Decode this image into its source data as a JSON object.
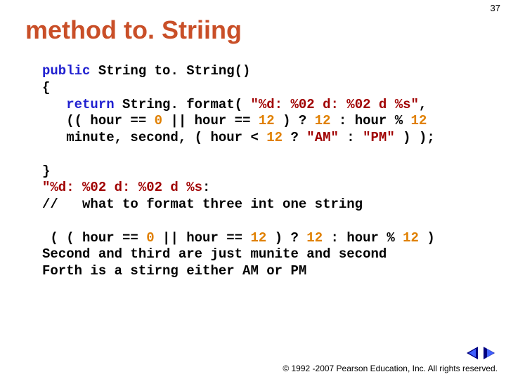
{
  "page_number": "37",
  "title": "method to. Striing",
  "code": {
    "l1a": "public",
    "l1b": " String to. String()",
    "l2": "{",
    "l3a": "   return",
    "l3b": " String. format( ",
    "l3c": "\"%d: %02 d: %02 d %s\"",
    "l3d": ",",
    "l4a": "   (( hour == ",
    "l4b": "0",
    "l4c": " || hour == ",
    "l4d": "12",
    "l4e": " ) ? ",
    "l4f": "12",
    "l4g": " : hour % ",
    "l4h": "12",
    "l5a": "   minute, second, ( hour < ",
    "l5b": "12",
    "l5c": " ? ",
    "l5d": "\"AM\"",
    "l5e": " : ",
    "l5f": "\"PM\"",
    "l5g": " ) );",
    "l6": "",
    "l7": "}",
    "l8a": "\"%d: %02 d: %02 d %s",
    "l8b": ":",
    "l9": "//   what to format three int one string",
    "l10": "",
    "l11a": " ( ( hour == ",
    "l11b": "0",
    "l11c": " || hour == ",
    "l11d": "12",
    "l11e": " ) ? ",
    "l11f": "12",
    "l11g": " : hour % ",
    "l11h": "12",
    "l11i": " )",
    "l12": "Second and third are just munite and second",
    "l13": "Forth is a stirng either AM or PM"
  },
  "copyright": "© 1992 -2007 Pearson Education, Inc. All rights reserved."
}
